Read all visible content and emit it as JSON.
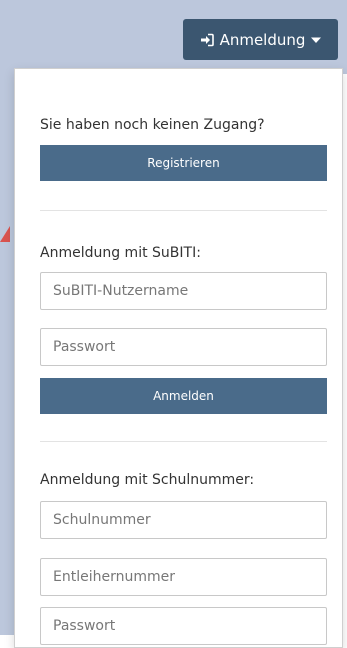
{
  "header": {
    "login_toggle_label": "Anmeldung",
    "login_icon": "sign-in-icon",
    "caret_icon": "caret-down-icon",
    "bar_color": "#bcc7dc",
    "button_color": "#3b5670"
  },
  "register_section": {
    "title": "Sie haben noch keinen Zugang?",
    "button_label": "Registrieren"
  },
  "subiti_section": {
    "title": "Anmeldung mit SuBITI:",
    "username_placeholder": "SuBITI-Nutzername",
    "password_placeholder": "Passwort",
    "submit_label": "Anmelden"
  },
  "school_section": {
    "title": "Anmeldung mit Schulnummer:",
    "school_number_placeholder": "Schulnummer",
    "borrower_number_placeholder": "Entleihernummer",
    "password_placeholder": "Passwort"
  },
  "colors": {
    "primary_button": "#4a6b8a",
    "pointer_arrow": "#d9534f"
  }
}
